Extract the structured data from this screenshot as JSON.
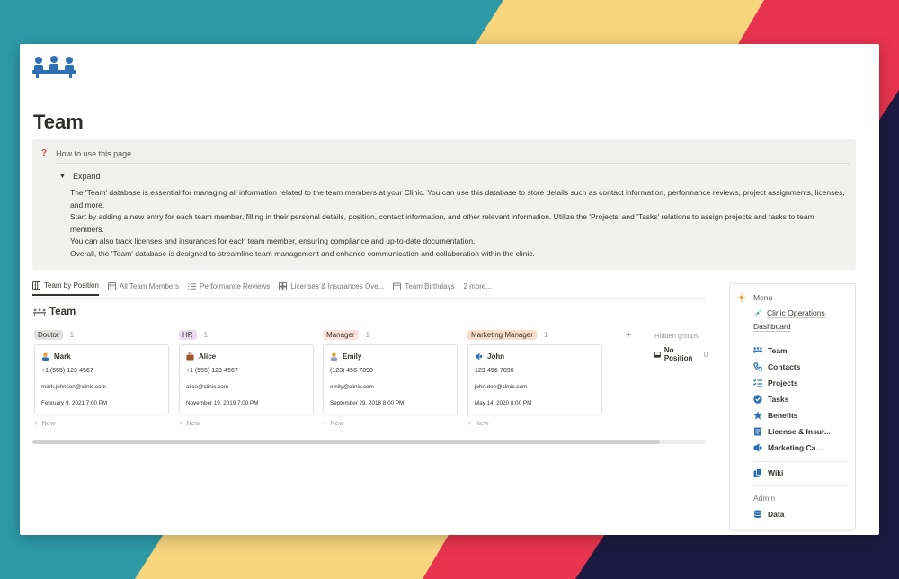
{
  "page": {
    "title": "Team",
    "icon": "team-meeting-icon"
  },
  "callout": {
    "icon": "question-mark-icon",
    "heading": "How to use this page",
    "toggle_label": "Expand",
    "paragraphs": [
      "The 'Team' database is essential for managing all information related to the team members at your Clinic. You can use this database to store details such as contact information, performance reviews, project assignments, licenses, and more.",
      "Start by adding a new entry for each team member, filling in their personal details, position, contact information, and other relevant information. Utilize the 'Projects' and 'Tasks' relations to assign projects and tasks to team members.",
      "You can also track licenses and insurances for each team member, ensuring compliance and up-to-date documentation.",
      "Overall, the 'Team' database is designed to streamline team management and enhance communication and collaboration within the clinic."
    ]
  },
  "tabs": [
    {
      "label": "Team by Position",
      "icon": "board-icon",
      "active": true
    },
    {
      "label": "All Team Members",
      "icon": "table-icon",
      "active": false
    },
    {
      "label": "Performance Reviews",
      "icon": "list-icon",
      "active": false
    },
    {
      "label": "Licenses & Insurances Ove...",
      "icon": "gallery-icon",
      "active": false
    },
    {
      "label": "Team Birthdays",
      "icon": "calendar-icon",
      "active": false
    },
    {
      "label": "2 more...",
      "icon": "",
      "active": false
    }
  ],
  "database": {
    "title": "Team",
    "new_label": "New",
    "hidden_groups_label": "Hidden groups",
    "no_position_label": "No Position",
    "no_position_count": "0",
    "columns": [
      {
        "tag": "Doctor",
        "tag_color": "#e3e2e0",
        "count": "1",
        "card": {
          "name": "Mark",
          "phone": "+1 (555) 123-4567",
          "email": "mark.johnson@clinic.com",
          "date": "February 9, 2021 7:00 PM",
          "avatar_color": "#e8a33d"
        }
      },
      {
        "tag": "HR",
        "tag_color": "#e8deee",
        "count": "1",
        "card": {
          "name": "Alice",
          "phone": "+1 (555) 123-4567",
          "email": "alice@clinic.com",
          "date": "November 19, 2019 7:00 PM",
          "avatar_color": "#a0522d"
        }
      },
      {
        "tag": "Manager",
        "tag_color": "#ffe2dd",
        "count": "1",
        "card": {
          "name": "Emily",
          "phone": "(123) 456-7890",
          "email": "emily@clinic.com",
          "date": "September 29, 2018 8:00 PM",
          "avatar_color": "#e8a33d"
        }
      },
      {
        "tag": "Marketing Manager",
        "tag_color": "#fadec9",
        "count": "1",
        "card": {
          "name": "John",
          "phone": "123-456-7890",
          "email": "john.doe@clinic.com",
          "date": "May 14, 2020 8:00 PM",
          "avatar_color": "#2f6fb3"
        }
      }
    ]
  },
  "menu": {
    "heading": "Menu",
    "dashboard_link": [
      "Clinic Operations",
      "Dashboard"
    ],
    "items": [
      {
        "label": "Team",
        "icon": "team-icon"
      },
      {
        "label": "Contacts",
        "icon": "phone-icon"
      },
      {
        "label": "Projects",
        "icon": "checklist-icon"
      },
      {
        "label": "Tasks",
        "icon": "check-circle-icon"
      },
      {
        "label": "Benefits",
        "icon": "star-icon"
      },
      {
        "label": "License & Insur...",
        "icon": "document-icon"
      },
      {
        "label": "Marketing Ca...",
        "icon": "megaphone-icon"
      }
    ],
    "wiki_label": "Wiki",
    "admin_label": "Admin",
    "data_label": "Data"
  },
  "colors": {
    "accent_blue": "#2f6fb3",
    "bg_teal": "#2e9aa8",
    "bg_yellow": "#f7d67e",
    "bg_red": "#e8344e",
    "bg_navy": "#1c1a40"
  }
}
